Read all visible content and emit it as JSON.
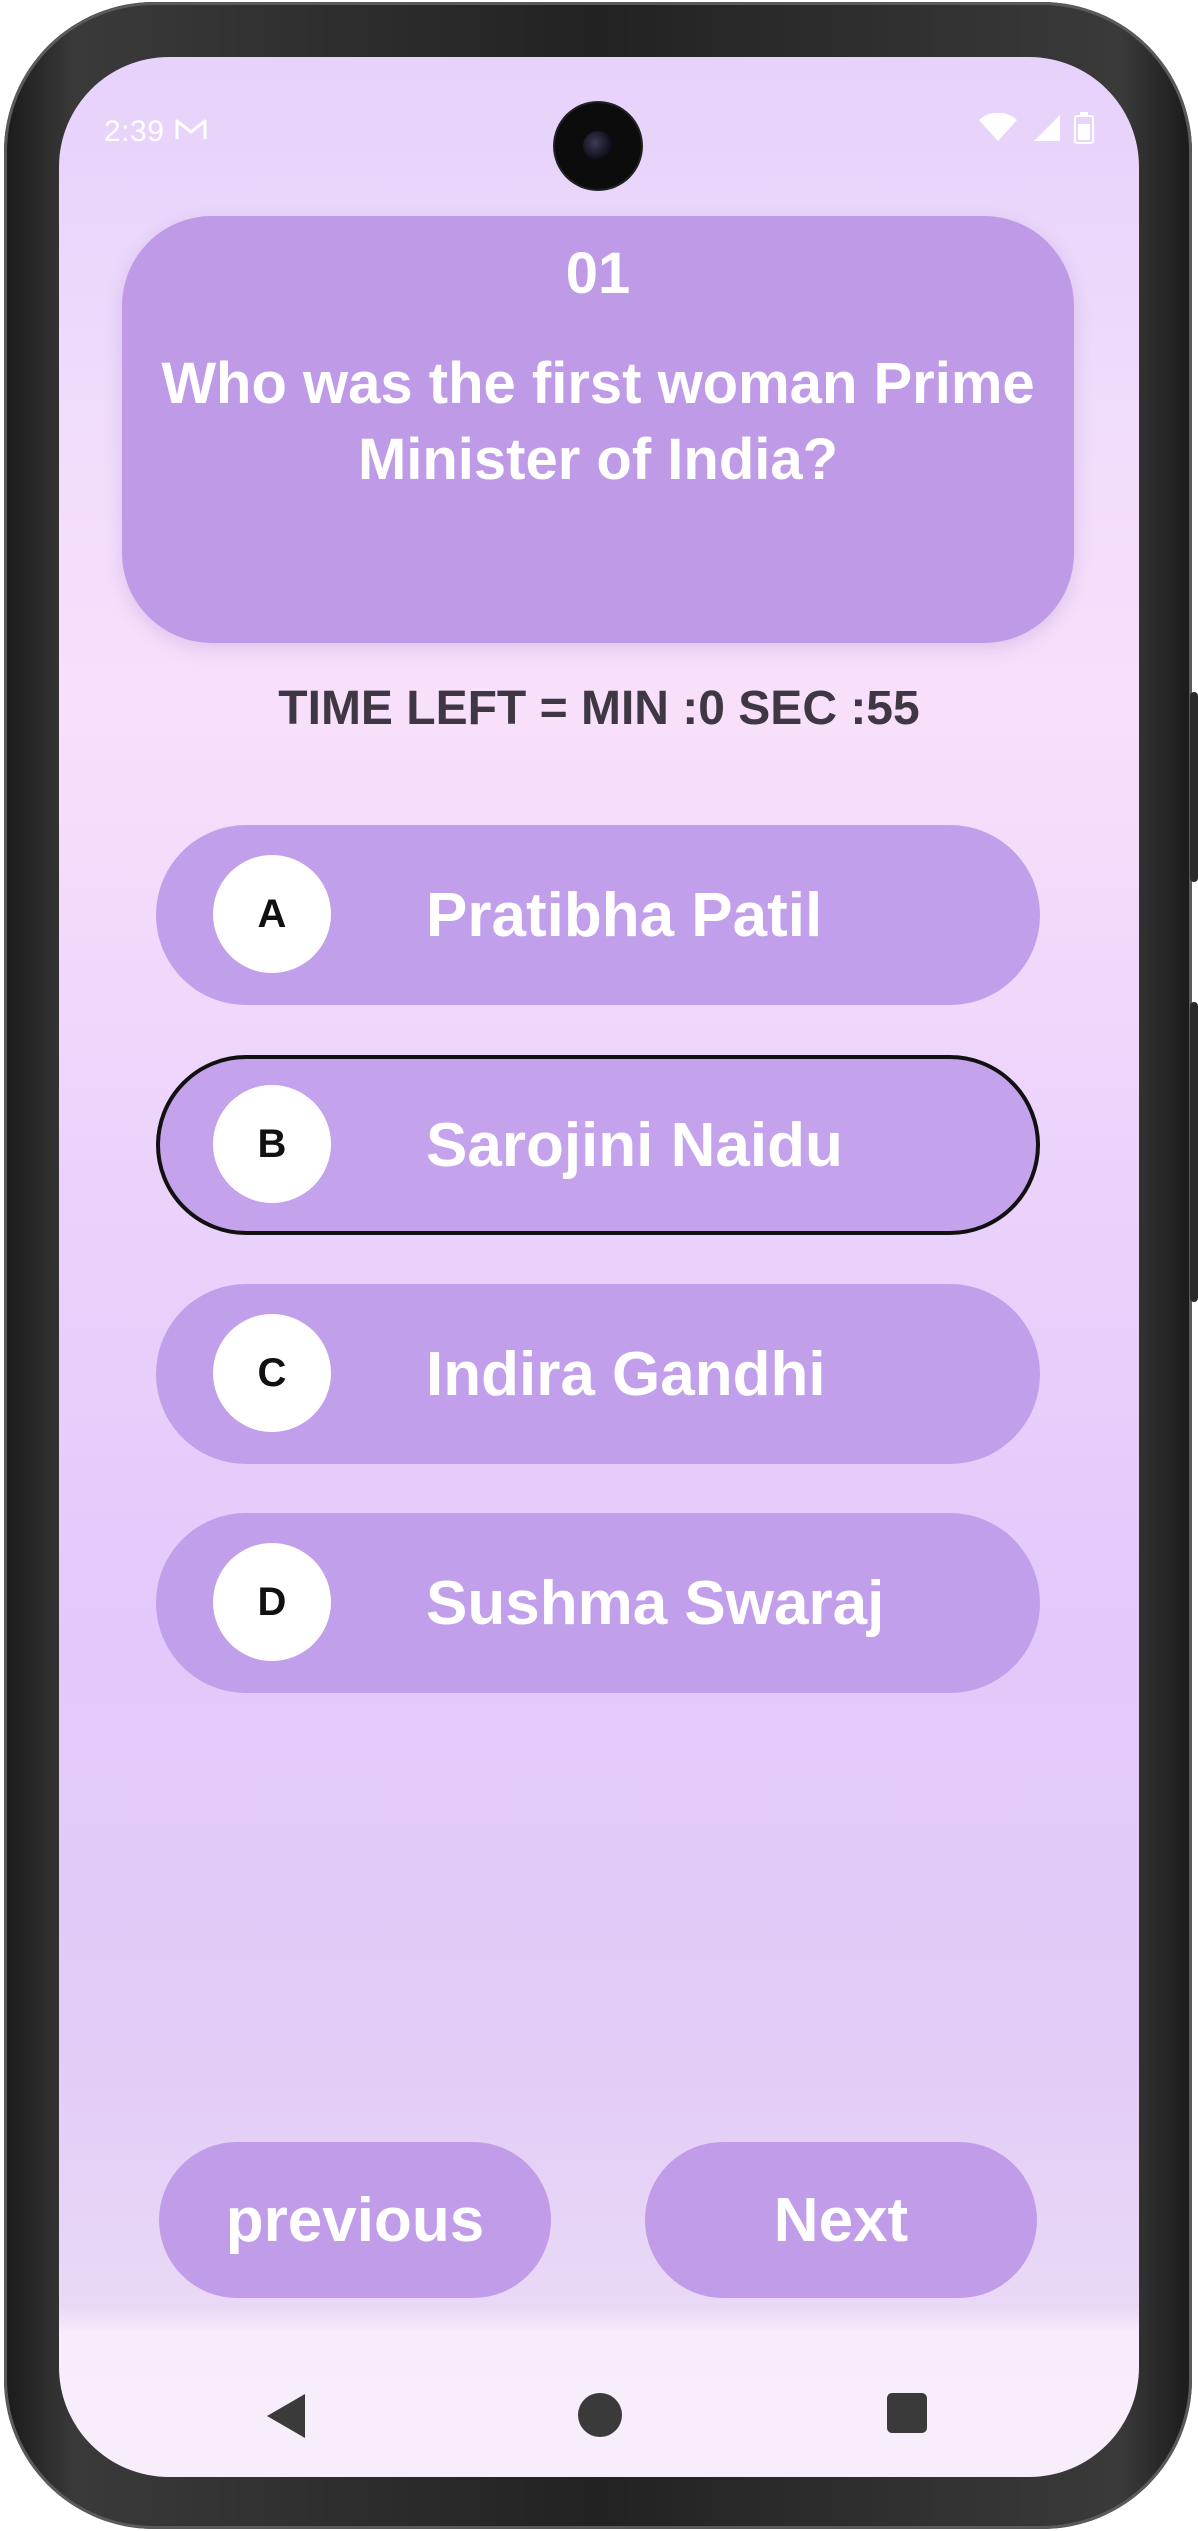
{
  "status_bar": {
    "time": "2:39",
    "mail_icon": "gmail-icon",
    "icons": [
      "wifi-icon",
      "signal-icon",
      "battery-icon"
    ]
  },
  "question": {
    "number": "01",
    "text": "Who was the first woman Prime Minister of India?"
  },
  "timer": {
    "text": "TIME LEFT = MIN :0 SEC :55"
  },
  "options": [
    {
      "letter": "A",
      "label": "Pratibha Patil",
      "selected": false
    },
    {
      "letter": "B",
      "label": "Sarojini Naidu",
      "selected": true
    },
    {
      "letter": "C",
      "label": "Indira Gandhi",
      "selected": false
    },
    {
      "letter": "D",
      "label": "Sushma Swaraj",
      "selected": false
    }
  ],
  "buttons": {
    "previous": "previous",
    "next": "Next"
  },
  "system_nav": {
    "icons": [
      "back-icon",
      "home-icon",
      "recents-icon"
    ]
  },
  "colors": {
    "card": "#bf9ae7",
    "option": "#c29fea",
    "timer_text": "#3f3844",
    "selected_border": "#111111"
  }
}
